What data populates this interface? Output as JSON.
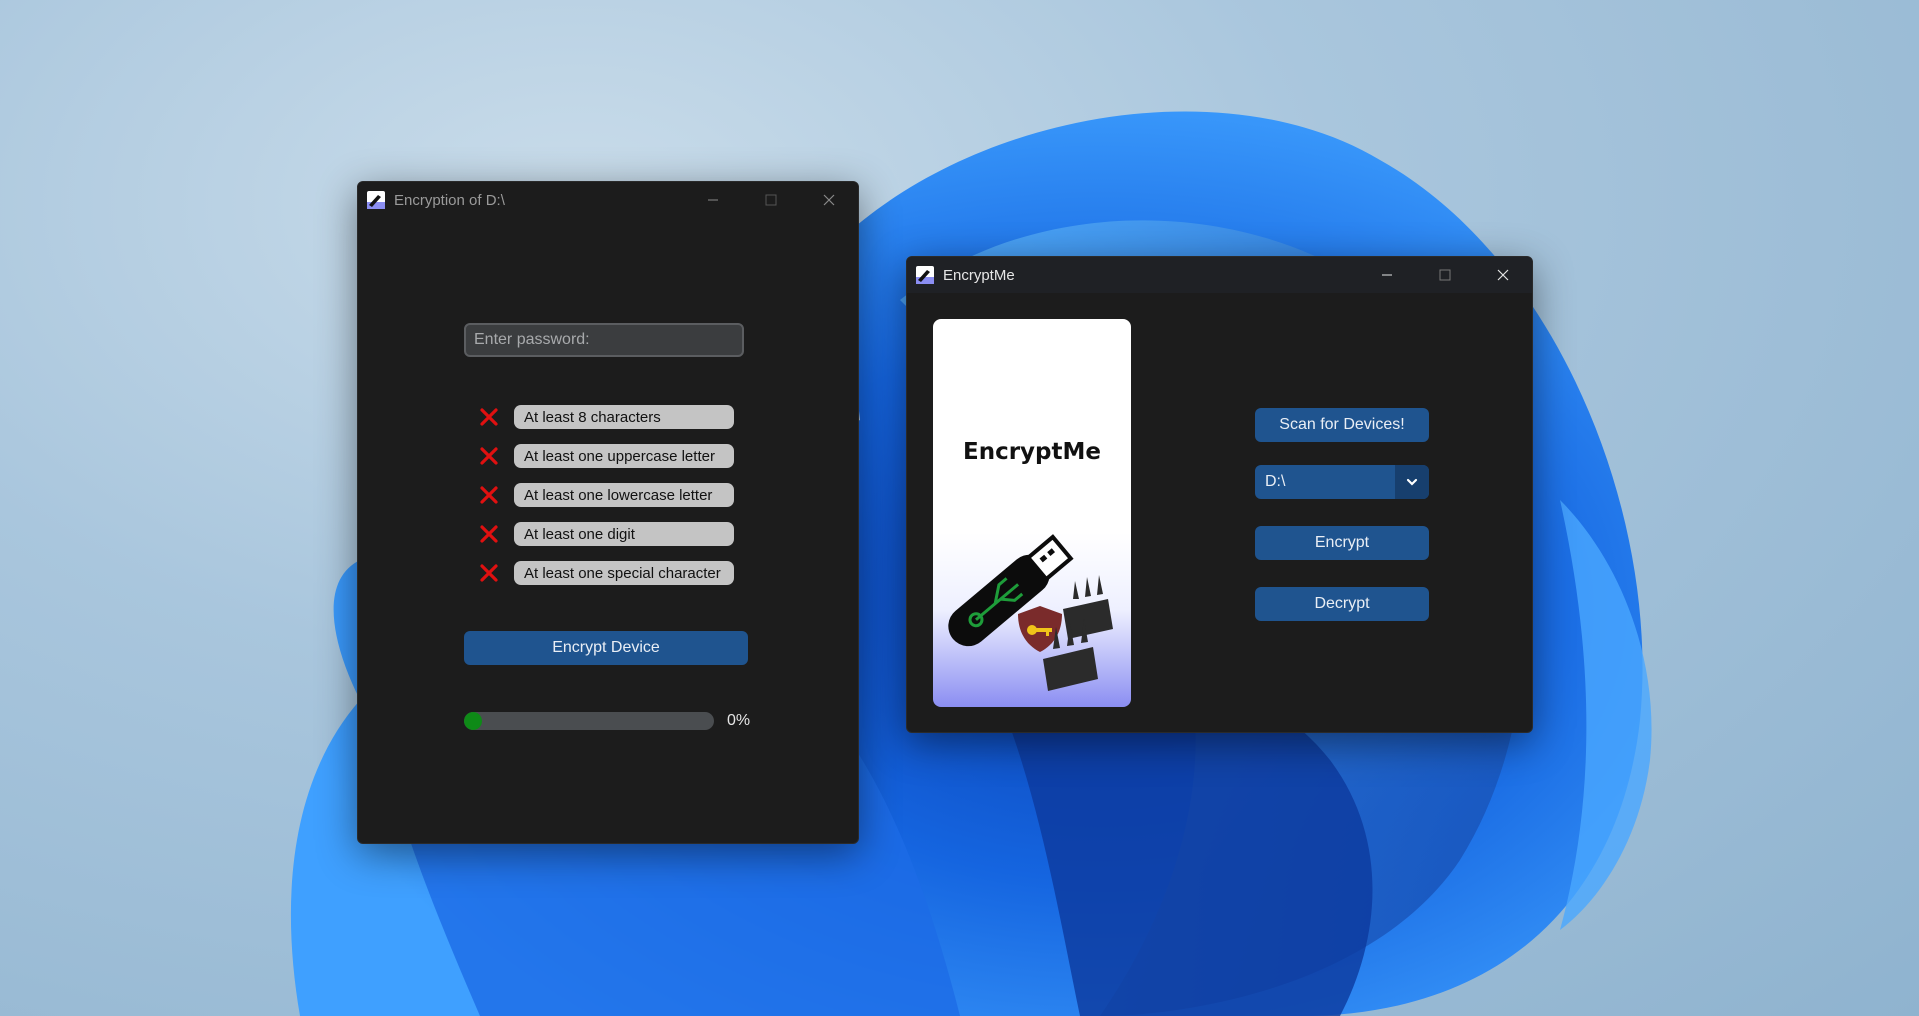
{
  "colors": {
    "button_bg": "#1f548f",
    "window_bg": "#1c1c1c",
    "error_x": "#e01010",
    "progress_fill": "#0e8a17",
    "pill_bg": "#c4c4c4"
  },
  "encryption_window": {
    "title": "Encryption of D:\\",
    "password_placeholder": "Enter password:",
    "requirements": [
      {
        "label": "At least 8 characters",
        "met": false
      },
      {
        "label": "At least one uppercase letter",
        "met": false
      },
      {
        "label": "At least one lowercase letter",
        "met": false
      },
      {
        "label": "At least one digit",
        "met": false
      },
      {
        "label": "At least one special character",
        "met": false
      }
    ],
    "encrypt_button": "Encrypt Device",
    "progress_fraction": 0.0,
    "progress_label": "0%"
  },
  "main_window": {
    "title": "EncryptMe",
    "logo_text": "EncryptMe",
    "scan_button": "Scan for Devices!",
    "device_select_value": "D:\\",
    "encrypt_button": "Encrypt",
    "decrypt_button": "Decrypt"
  }
}
